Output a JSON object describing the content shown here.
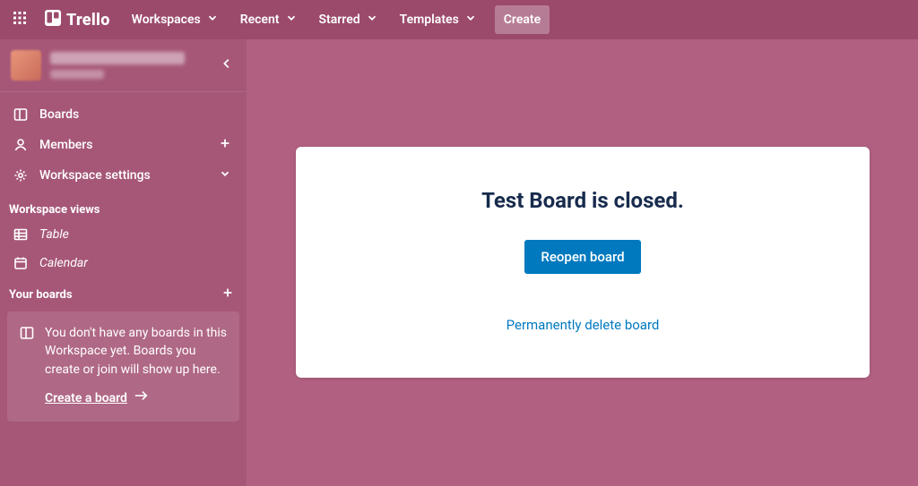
{
  "topbar": {
    "brand": "Trello",
    "nav": [
      {
        "label": "Workspaces"
      },
      {
        "label": "Recent"
      },
      {
        "label": "Starred"
      },
      {
        "label": "Templates"
      }
    ],
    "create_label": "Create"
  },
  "sidebar": {
    "items": [
      {
        "label": "Boards"
      },
      {
        "label": "Members"
      },
      {
        "label": "Workspace settings"
      }
    ],
    "views_heading": "Workspace views",
    "views": [
      {
        "label": "Table"
      },
      {
        "label": "Calendar"
      }
    ],
    "boards_heading": "Your boards",
    "empty_boards_text": "You don't have any boards in this Workspace yet. Boards you create or join will show up here.",
    "create_board_label": "Create a board"
  },
  "main": {
    "closed_title": "Test Board is closed.",
    "reopen_label": "Reopen board",
    "delete_label": "Permanently delete board"
  },
  "colors": {
    "accent_blue": "#0079bf",
    "bg_pink": "#b16082",
    "sidebar_pink": "#a65778",
    "topbar_pink": "#9b4a6c",
    "text_dark": "#172b4d",
    "arrow_orange": "#f97316"
  }
}
